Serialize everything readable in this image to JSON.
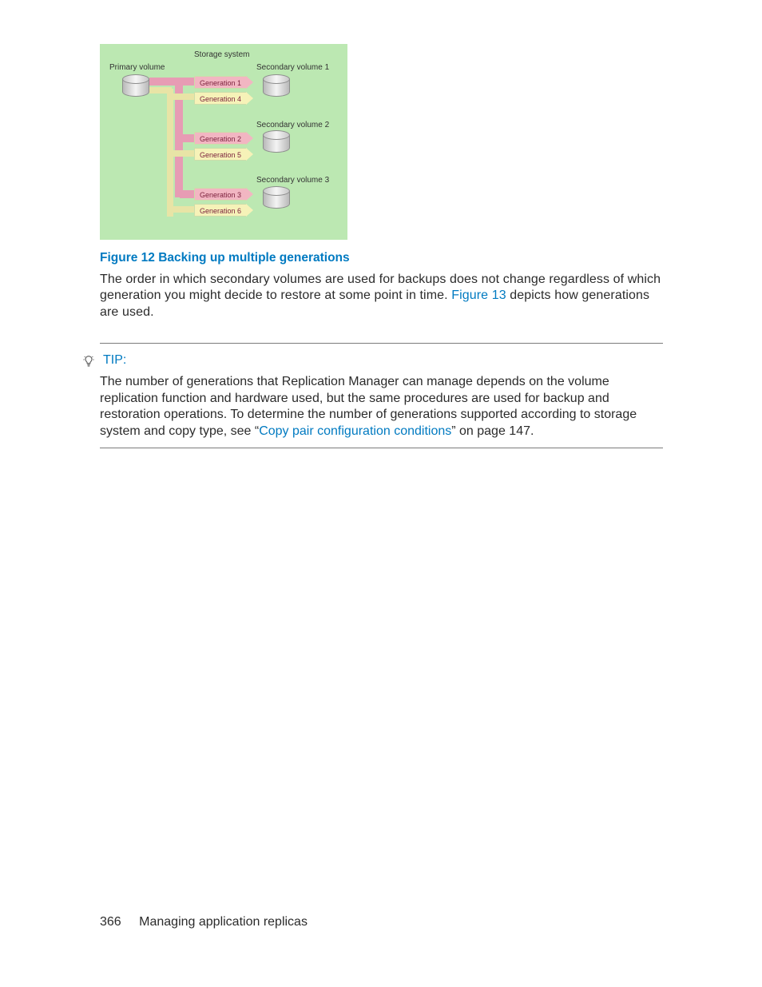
{
  "diagram": {
    "storage_system": "Storage system",
    "primary": "Primary volume",
    "secondary": [
      "Secondary volume 1",
      "Secondary volume 2",
      "Secondary volume 3"
    ],
    "generations": [
      "Generation 1",
      "Generation 2",
      "Generation 3",
      "Generation 4",
      "Generation 5",
      "Generation 6"
    ]
  },
  "caption": "Figure 12 Backing up multiple generations",
  "para_before_link": "The order in which secondary volumes are used for backups does not change regardless of which generation you might decide to restore at some point in time. ",
  "para_link": "Figure 13",
  "para_after_link": " depicts how generations are used.",
  "tip": {
    "label": "TIP:",
    "body_before": "The number of generations that Replication Manager can manage depends on the volume replication function and hardware used, but the same procedures are used for backup and restoration operations. To determine the number of generations supported according to storage system and copy type, see “",
    "link": "Copy pair configuration conditions",
    "body_after": "” on page 147."
  },
  "footer": {
    "page_number": "366",
    "section": "Managing application replicas"
  }
}
